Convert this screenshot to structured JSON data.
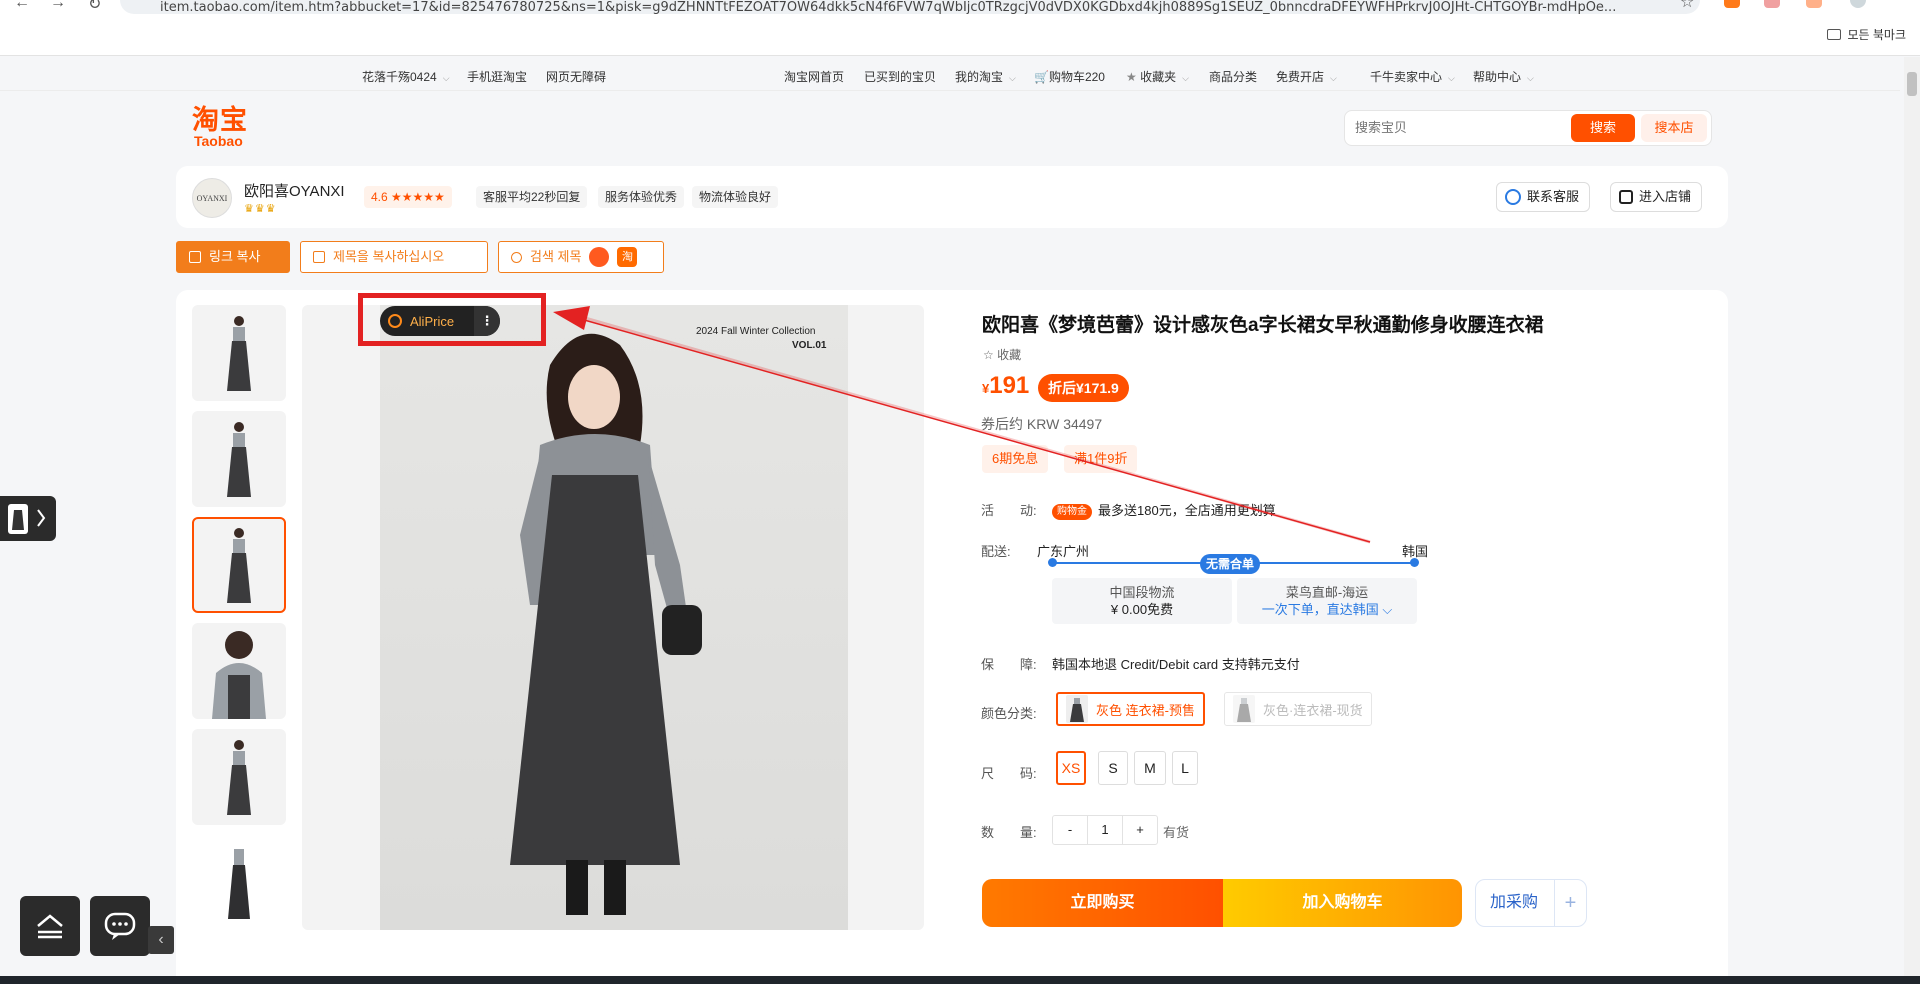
{
  "browser": {
    "url": "item.taobao.com/item.htm?abbucket=17&id=825476780725&ns=1&pisk=g9dZHNNTtFEZOAT7OW64dkk5cN4f6FVW7qWbIjc0TRzgcjV0dVDX0KGDbxd4kjh0889Sg1SEUZ_0bnncdraDFEYWFHPrkrvJ0OJHt-CHTGOYBr-mdHpOe...",
    "bookmarks_label": "모든 북마크"
  },
  "sitebar": {
    "user": "花落千殇0424",
    "mobile": "手机逛淘宝",
    "accessibility": "网页无障碍",
    "home": "淘宝网首页",
    "bought": "已买到的宝贝",
    "my_taobao": "我的淘宝",
    "cart": "购物车220",
    "favorites": "收藏夹",
    "categories": "商品分类",
    "open_shop": "免费开店",
    "seller": "千牛卖家中心",
    "help": "帮助中心"
  },
  "header": {
    "logo_cn": "淘宝",
    "logo_en": "Taobao",
    "search_placeholder": "搜索宝贝",
    "search_btn": "搜索",
    "search_shop_btn": "搜本店"
  },
  "shop": {
    "avatar_text": "OYANXI",
    "name": "欧阳喜OYANXI",
    "crowns": "♛♛♛",
    "rating": "4.6 ★★★★★",
    "tags": [
      "客服平均22秒回复",
      "服务体验优秀",
      "物流体验良好"
    ],
    "contact_btn": "联系客服",
    "enter_btn": "进入店铺"
  },
  "tools": {
    "copy_link": "링크 복사",
    "copy_title": "제목을 복사하십시오",
    "search_title": "검색 제목",
    "taobao_badge": "淘"
  },
  "gallery": {
    "collection": "2024 Fall Winter Collection",
    "volume": "VOL.01",
    "aliprice": "AliPrice",
    "aliprice_menu": "⋮"
  },
  "product": {
    "title": "欧阳喜《梦境芭蕾》设计感灰色a字长裙女早秋通勤修身收腰连衣裙",
    "favorite": "☆ 收藏",
    "currency": "¥",
    "price": "191",
    "discount": "折后¥171.9",
    "coupon_krw": "券后约 KRW 34497",
    "promos": [
      "6期免息",
      "满1件9折"
    ],
    "activity_label": "活　　动:",
    "activity_badge": "购物金",
    "activity_text": "最多送180元，全店通用更划算",
    "shipping_label": "配送:",
    "ship_from": "广东广州",
    "ship_to": "韩国",
    "ship_tag": "无需合单",
    "ship_opt1_name": "中国段物流",
    "ship_opt1_value": "¥ 0.00免费",
    "ship_opt2_name": "菜鸟直邮-海运",
    "ship_opt2_value": "一次下单，直达韩国 ⌵",
    "guarantee_label": "保　　障:",
    "guarantee_text": "韩国本地退 Credit/Debit card 支持韩元支付",
    "color_label": "颜色分类:",
    "colors": [
      "灰色 连衣裙-预售",
      "灰色·连衣裙-现货"
    ],
    "size_label": "尺　　码:",
    "sizes": [
      "XS",
      "S",
      "M",
      "L"
    ],
    "qty_label": "数　　量:",
    "qty_minus": "-",
    "qty_value": "1",
    "qty_plus": "+",
    "stock": "有货",
    "buy_now": "立即购买",
    "add_cart": "加入购物车",
    "purchase": "加采购",
    "purchase_plus": "+"
  },
  "colors": {
    "brand": "#ff5000",
    "accent_blue": "#2a7ae2",
    "annotation_red": "#e32222"
  }
}
